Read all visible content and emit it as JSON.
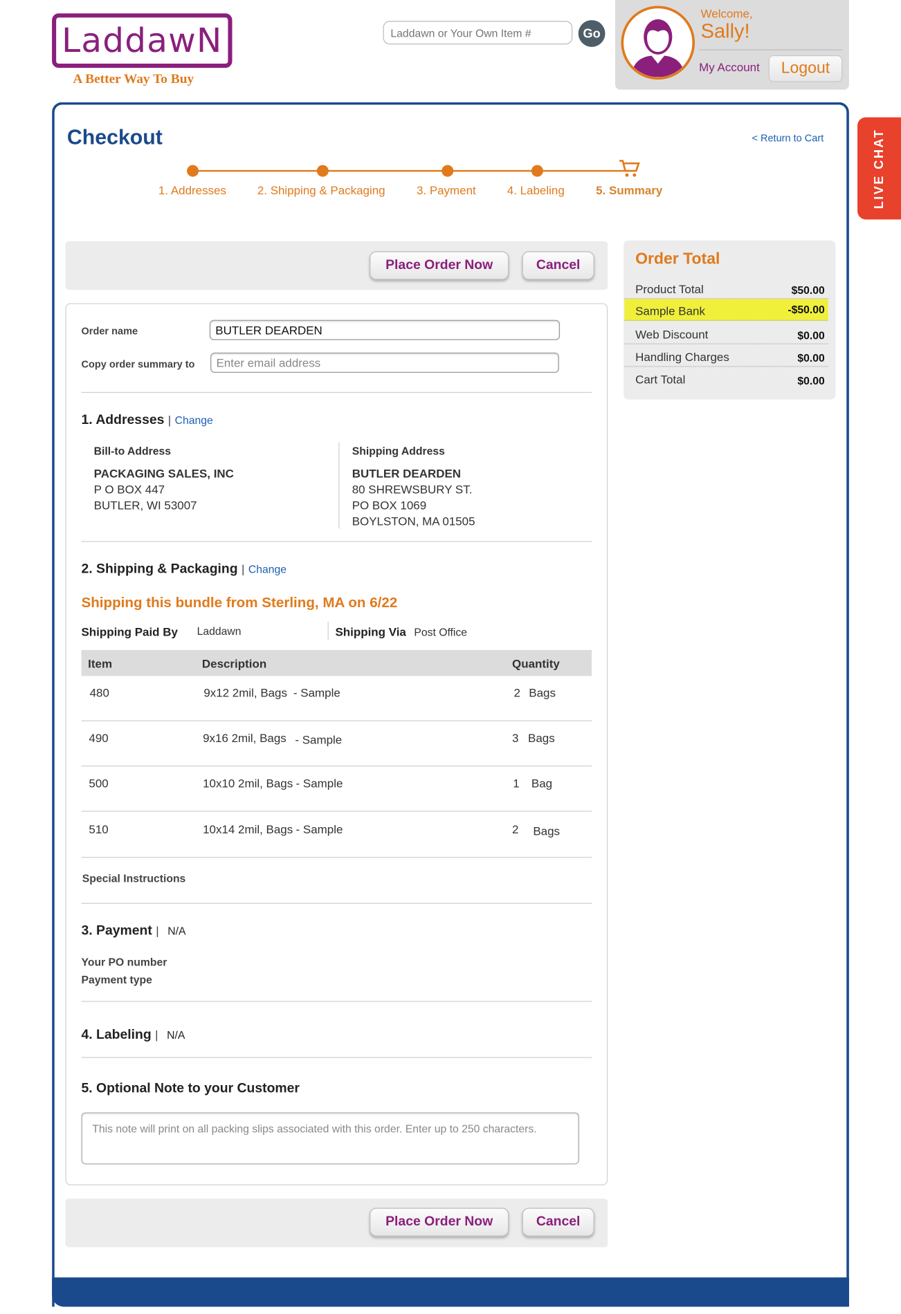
{
  "header": {
    "logo_text": "LaddawN",
    "tagline": "A Better Way To Buy",
    "search": {
      "placeholder": "Laddawn or Your Own Item #"
    },
    "go_label": "Go",
    "welcome": "Welcome,",
    "username": "Sally!",
    "my_account": "My Account",
    "logout": "Logout"
  },
  "live_chat": "LIVE CHAT",
  "page": {
    "title": "Checkout",
    "return_link": "< Return to Cart"
  },
  "steps": [
    {
      "label": "1. Addresses"
    },
    {
      "label": "2. Shipping & Packaging"
    },
    {
      "label": "3. Payment"
    },
    {
      "label": "4. Labeling"
    },
    {
      "label": "5. Summary"
    }
  ],
  "buttons": {
    "place_order": "Place Order Now",
    "cancel": "Cancel"
  },
  "order_total": {
    "title": "Order Total",
    "rows": [
      {
        "label": "Product Total",
        "value": "$50.00"
      },
      {
        "label": "Sample Bank",
        "value": "-$50.00"
      },
      {
        "label": "Web Discount",
        "value": "$0.00"
      },
      {
        "label": "Handling Charges",
        "value": "$0.00"
      },
      {
        "label": "Cart Total",
        "value": "$0.00"
      }
    ]
  },
  "order_form": {
    "order_name_label": "Order name",
    "order_name_value": "BUTLER DEARDEN",
    "copy_label": "Copy order summary to",
    "copy_placeholder": "Enter email address"
  },
  "addresses": {
    "heading": "1. Addresses",
    "change": "Change",
    "bill_title": "Bill-to Address",
    "bill_lines": [
      "PACKAGING SALES, INC",
      "P O BOX 447",
      "BUTLER, WI 53007"
    ],
    "ship_title": "Shipping Address",
    "ship_lines": [
      "BUTLER DEARDEN",
      "80 SHREWSBURY ST.",
      "PO BOX 1069",
      "BOYLSTON, MA 01505"
    ]
  },
  "shipping": {
    "heading": "2. Shipping & Packaging",
    "change": "Change",
    "bundle_note": "Shipping this bundle from Sterling, MA on 6/22",
    "paid_by_label": "Shipping Paid By",
    "paid_by_value": "Laddawn",
    "via_label": "Shipping Via",
    "via_value": "Post Office",
    "columns": [
      "Item",
      "Description",
      "Quantity"
    ],
    "items": [
      {
        "item": "480",
        "desc": "9x12 2mil, Bags",
        "type": "- Sample",
        "qty": "2",
        "unit": "Bags"
      },
      {
        "item": "490",
        "desc": "9x16 2mil, Bags",
        "type": "- Sample",
        "qty": "3",
        "unit": "Bags"
      },
      {
        "item": "500",
        "desc": "10x10 2mil, Bags",
        "type": "- Sample",
        "qty": "1",
        "unit": "Bag"
      },
      {
        "item": "510",
        "desc": "10x14 2mil, Bags",
        "type": "- Sample",
        "qty": "2",
        "unit": "Bags"
      }
    ],
    "special_instructions": "Special Instructions"
  },
  "payment": {
    "heading": "3. Payment",
    "value": "N/A",
    "po_label": "Your PO number",
    "type_label": "Payment type"
  },
  "labeling": {
    "heading": "4. Labeling",
    "value": "N/A"
  },
  "note": {
    "heading": "5. Optional Note to your Customer",
    "placeholder": "This note will print on all packing slips associated with this order. Enter up to 250 characters."
  },
  "colors": {
    "brand_purple": "#8a1f7c",
    "brand_orange": "#e07a1c",
    "frame_blue": "#1a4a8c",
    "highlight_yellow": "#f0f03a",
    "live_chat_red": "#e8412c"
  }
}
